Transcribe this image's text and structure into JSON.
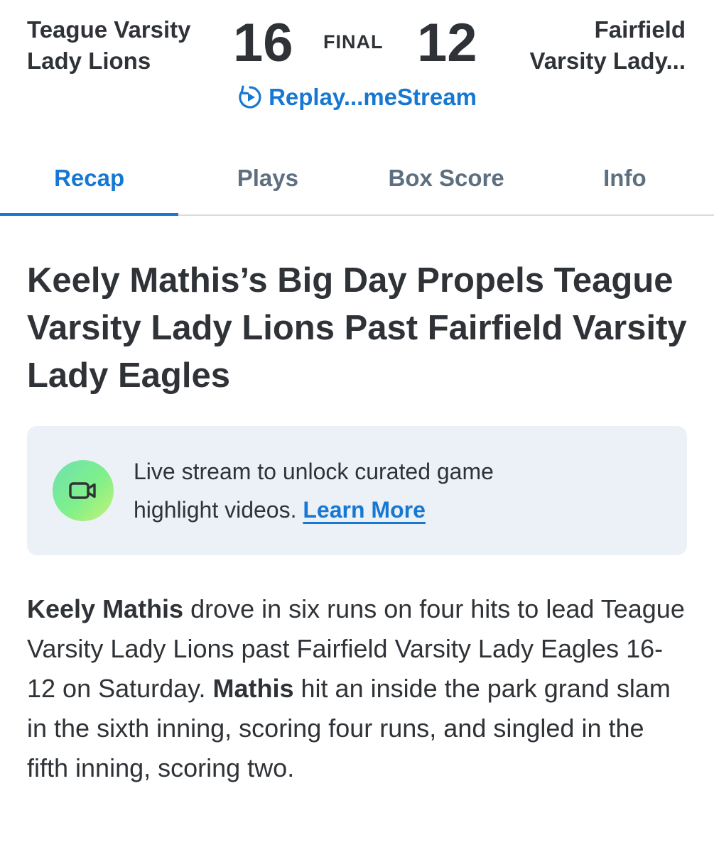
{
  "game": {
    "home_team_line1": "Teague Varsity",
    "home_team_line2": "Lady Lions",
    "home_score": "16",
    "status": "FINAL",
    "away_score": "12",
    "away_team_line1": "Fairfield",
    "away_team_line2": "Varsity Lady...",
    "replay_label": "Replay...meStream",
    "replay_icon": "replay-icon",
    "accent_color": "#1778d3"
  },
  "tabs": [
    {
      "label": "Recap",
      "active": true
    },
    {
      "label": "Plays",
      "active": false
    },
    {
      "label": "Box Score",
      "active": false
    },
    {
      "label": "Info",
      "active": false
    }
  ],
  "recap": {
    "headline": "Keely Mathis’s Big Day Propels Teague Varsity Lady Lions Past Fairfield Varsity Lady Eagles",
    "promo": {
      "icon": "video-camera-icon",
      "text": "Live stream to unlock curated game highlight videos. ",
      "link_label": "Learn More"
    },
    "body": {
      "p1_bold": "Keely Mathis",
      "p1_text": " drove in six runs on four hits to lead Teague Varsity Lady Lions past Fairfield Varsity Lady Eagles 16-12 on Saturday. ",
      "p2_bold": "Mathis",
      "p2_text": " hit an inside the park grand slam in the sixth inning, scoring four runs, and singled in the fifth inning, scoring two."
    }
  }
}
